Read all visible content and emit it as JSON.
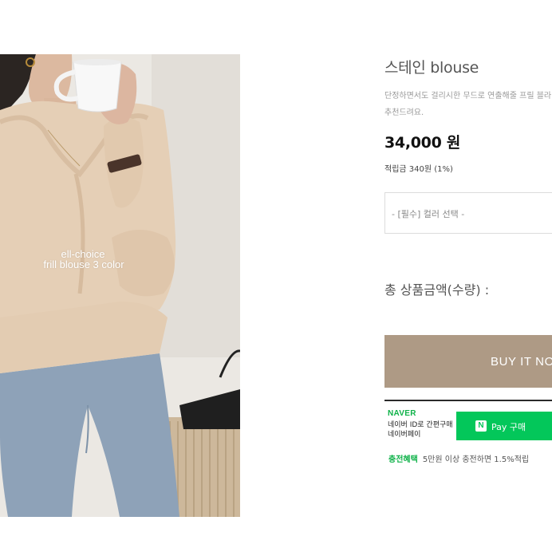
{
  "photo": {
    "watermark_line1": "ell-choice",
    "watermark_line2": "frill blouse 3 color"
  },
  "product": {
    "name": "스테인 blouse",
    "summary_line1": "단정하면서도 걸리시한 무드로 연출해줄 프릴 블라",
    "summary_line2": "추천드려요.",
    "price": "34,000 원",
    "points": "적립금 340원 (1%)",
    "option_placeholder": "- [필수] 컬러 선택 -",
    "total_label": "총 상품금액(수량) :",
    "buy_label": "BUY IT NOW"
  },
  "naver_pay": {
    "logo": "NAVER",
    "desc_line1": "네이버 ID로 간편구매",
    "desc_line2": "네이버페이",
    "button_mark": "N",
    "button_label": "Pay 구매",
    "benefit_highlight": "충전혜택",
    "benefit_text": "5만원 이상 충전하면 1.5%적립"
  },
  "colors": {
    "buy_button": "#ae9a85",
    "naver_green": "#03c75a",
    "blouse": "#e5cfb6",
    "jeans": "#8ea2b8"
  }
}
